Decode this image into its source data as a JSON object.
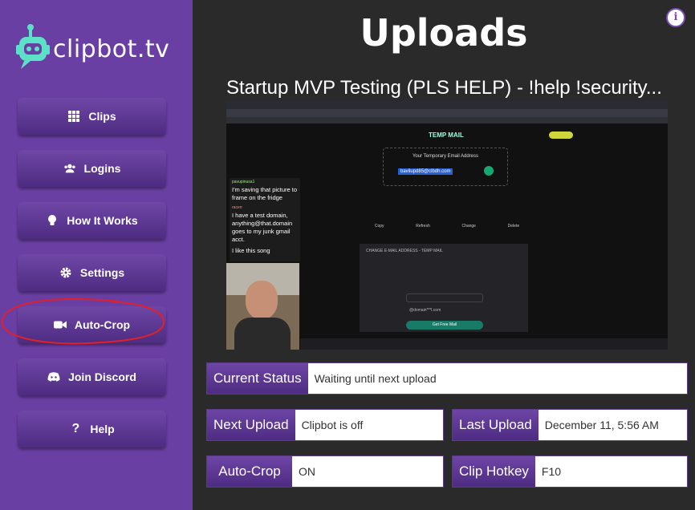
{
  "brand": {
    "name": "clipbot.tv"
  },
  "sidebar": {
    "items": [
      {
        "label": "Clips",
        "icon": "grid-icon"
      },
      {
        "label": "Logins",
        "icon": "users-icon"
      },
      {
        "label": "How It Works",
        "icon": "lightbulb-icon"
      },
      {
        "label": "Settings",
        "icon": "gear-icon"
      },
      {
        "label": "Auto-Crop",
        "icon": "video-camera-icon"
      },
      {
        "label": "Join Discord",
        "icon": "discord-icon"
      },
      {
        "label": "Help",
        "icon": "question-icon"
      }
    ]
  },
  "main": {
    "title": "Uploads",
    "info_symbol": "i",
    "clip_title": "Startup MVP Testing (PLS HELP) - !help !security...",
    "preview": {
      "site_title": "TEMP MAIL",
      "email_header": "Your Temporary Email Address",
      "email": "bavilupd85@clbdh.com",
      "actions": [
        "Copy",
        "Refresh",
        "Change",
        "Delete"
      ],
      "chat": [
        {
          "user": "pavupinusa1",
          "message": "I'm saving that picture to frame on the fridge"
        },
        {
          "user": "racerr",
          "message": "I have a test domain, anything@that.domain goes to my junk gmail acct."
        },
        {
          "user": "",
          "message": "I like this song"
        }
      ],
      "form_title": "CHANGE E-MAIL ADDRESS - TEMP MAIL",
      "form_value": "@domain***l.com",
      "form_button": "Get Free Mail"
    },
    "status": {
      "current_status": {
        "label": "Current Status",
        "value": "Waiting until next upload"
      },
      "next_upload": {
        "label": "Next Upload",
        "value": "Clipbot is off"
      },
      "last_upload": {
        "label": "Last Upload",
        "value": "December 11, 5:56 AM"
      },
      "auto_crop": {
        "label": "Auto-Crop",
        "value": "ON"
      },
      "clip_hotkey": {
        "label": "Clip Hotkey",
        "value": "F10"
      }
    }
  },
  "colors": {
    "sidebar": "#6a3fa4",
    "background": "#2a2a2a",
    "accent": "#5de0c8",
    "annotation": "#e0202a"
  }
}
